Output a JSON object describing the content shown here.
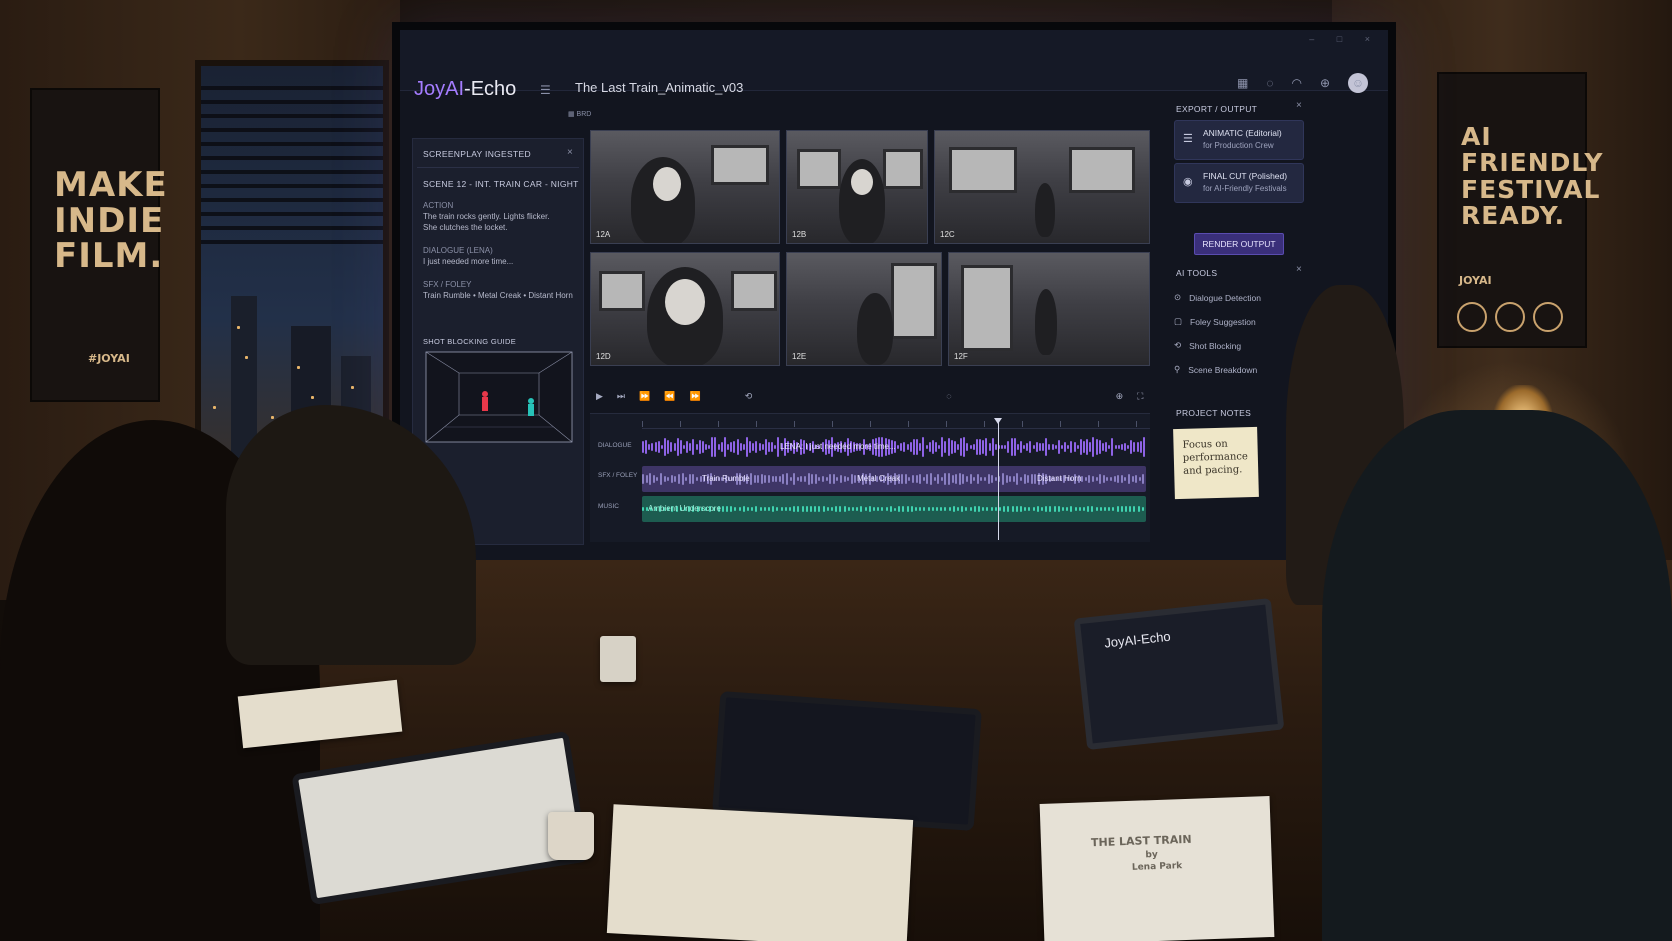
{
  "app": {
    "name_prefix": "JoyAI",
    "name_suffix": "-Echo",
    "document_title": "The Last Train_Animatic_v03"
  },
  "left_panel": {
    "header": "SCREENPLAY INGESTED",
    "scene": "SCENE 12 - INT. TRAIN CAR - NIGHT",
    "action_label": "ACTION",
    "action_text_1": "The train rocks gently. Lights flicker.",
    "action_text_2": "She clutches the locket.",
    "dialogue_label": "DIALOGUE (LENA)",
    "dialogue_text": "I just needed more time...",
    "sfx_label": "SFX / FOLEY",
    "sfx_text": "Train Rumble • Metal Creak • Distant Horn",
    "blocking_header": "SHOT BLOCKING GUIDE"
  },
  "storyboard": {
    "frames": [
      {
        "label": "12A"
      },
      {
        "label": "12B"
      },
      {
        "label": "12C"
      },
      {
        "label": "12D"
      },
      {
        "label": "12E"
      },
      {
        "label": "12F"
      }
    ]
  },
  "timeline": {
    "tracks": [
      {
        "label": "DIALOGUE",
        "clip": "LENA: I just needed more time...",
        "color": "#8e63e6"
      },
      {
        "label": "SFX / FOLEY",
        "clips": [
          "Train Rumble",
          "Metal Creak",
          "Distant Horn"
        ],
        "color": "#6b5aa0"
      },
      {
        "label": "MUSIC",
        "clip": "Ambient Underscore",
        "color": "#2fa58a"
      }
    ]
  },
  "right_panel": {
    "export_header": "EXPORT / OUTPUT",
    "animatic_title": "ANIMATIC (Editorial)",
    "animatic_sub": "for Production Crew",
    "final_title": "FINAL CUT (Polished)",
    "final_sub": "for AI-Friendly Festivals",
    "render_button": "RENDER OUTPUT",
    "tools_header": "AI TOOLS",
    "tools": [
      "Dialogue Detection",
      "Foley Suggestion",
      "Shot Blocking",
      "Scene Breakdown"
    ],
    "notes_header": "PROJECT NOTES",
    "note": "Focus on performance and pacing."
  },
  "posters": {
    "left": [
      "MAKE",
      "INDIE",
      "FILM."
    ],
    "left_brand": "#JOYAI",
    "right": [
      "AI",
      "FRIENDLY",
      "FESTIVAL",
      "READY."
    ],
    "right_brand": "JOYAI"
  },
  "laptop": {
    "logo": "JoyAI-Echo"
  },
  "script_cover": {
    "title": "THE LAST TRAIN",
    "by": "by",
    "author": "Lena Park"
  }
}
